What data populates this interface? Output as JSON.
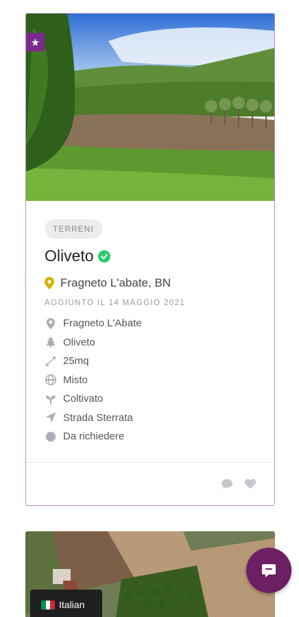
{
  "listing": {
    "category": "TERRENI",
    "title": "Oliveto",
    "location": "Fragneto L'abate, BN",
    "added_date": "AGGIUNTO IL 14 MAGGIO 2021",
    "attributes": [
      {
        "icon": "map-pin-icon",
        "label": "Fragneto L'Abate"
      },
      {
        "icon": "tree-icon",
        "label": "Oliveto"
      },
      {
        "icon": "expand-arrows-icon",
        "label": "25mq"
      },
      {
        "icon": "globe-icon",
        "label": "Misto"
      },
      {
        "icon": "seedling-icon",
        "label": "Coltivato"
      },
      {
        "icon": "location-arrow-icon",
        "label": "Strada Sterrata"
      },
      {
        "icon": "certificate-icon",
        "label": "Da richiedere"
      }
    ]
  },
  "language": {
    "label": "Italian"
  },
  "colors": {
    "accent": "#7b2b8d",
    "chat_button": "#6d1f63",
    "verified": "#2ecc71",
    "pin": "#d4b106"
  }
}
